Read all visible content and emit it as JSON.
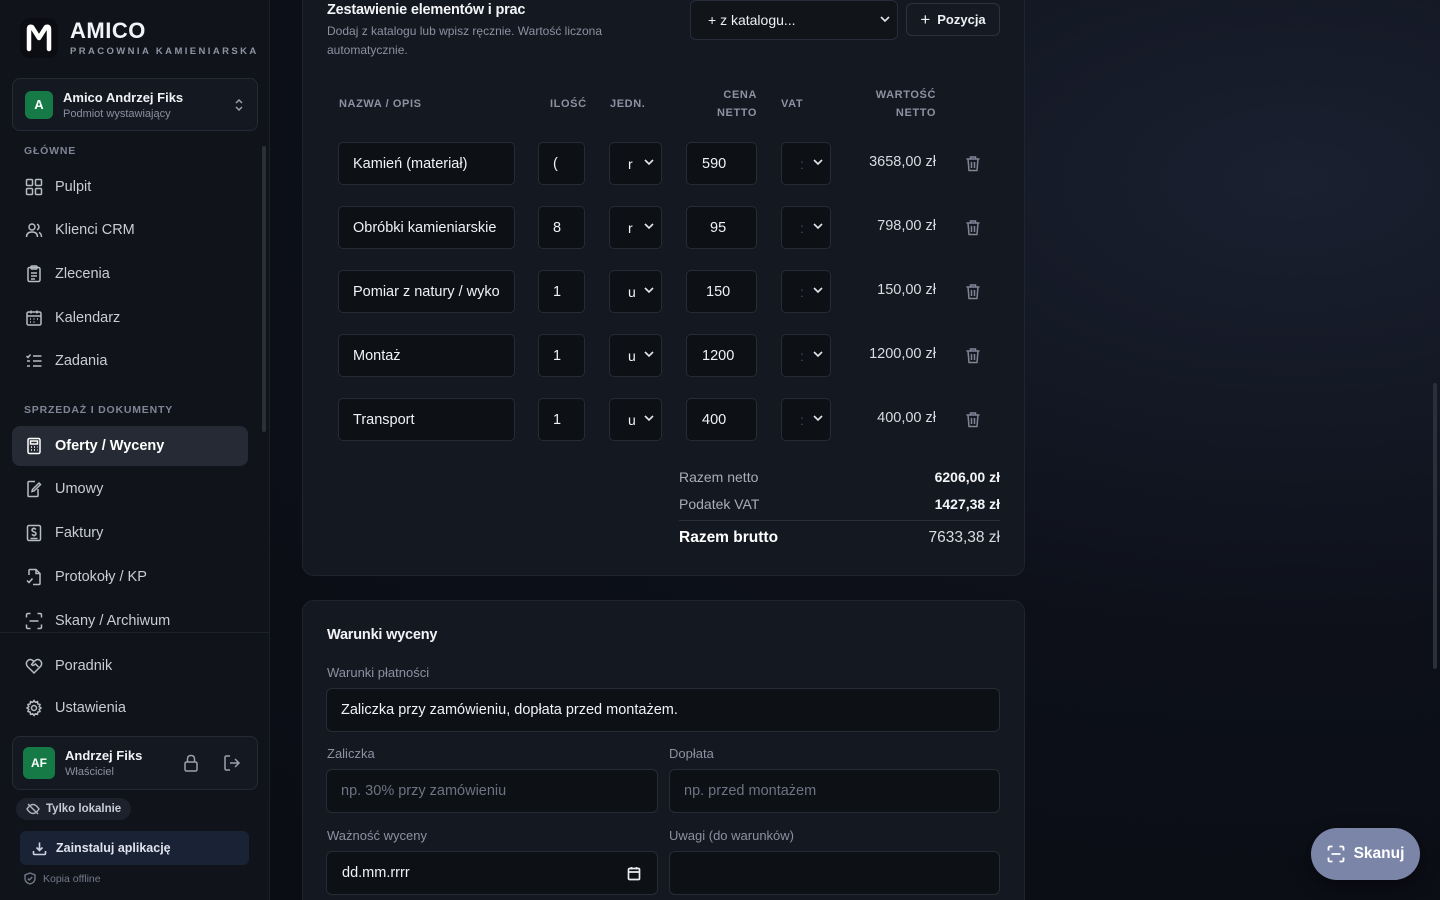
{
  "brand": {
    "name": "AMICO",
    "subtitle": "PRACOWNIA KAMIENIARSKA",
    "logo_letter": "M"
  },
  "entity": {
    "initial": "A",
    "name": "Amico Andrzej Fiks",
    "role": "Podmiot wystawiający"
  },
  "sidebar": {
    "section_main": "GŁÓWNE",
    "section_sales": "SPRZEDAŻ I DOKUMENTY",
    "items": [
      {
        "label": "Pulpit",
        "icon": "grid-icon"
      },
      {
        "label": "Klienci CRM",
        "icon": "users-icon"
      },
      {
        "label": "Zlecenia",
        "icon": "clipboard-icon"
      },
      {
        "label": "Kalendarz",
        "icon": "calendar-icon"
      },
      {
        "label": "Zadania",
        "icon": "tasks-icon"
      },
      {
        "label": "Oferty / Wyceny",
        "icon": "calculator-icon",
        "active": true
      },
      {
        "label": "Umowy",
        "icon": "contract-icon"
      },
      {
        "label": "Faktury",
        "icon": "invoice-icon"
      },
      {
        "label": "Protokoły / KP",
        "icon": "protocol-icon"
      },
      {
        "label": "Skany / Archiwum",
        "icon": "scan-icon"
      },
      {
        "label": "Poradnik",
        "icon": "heart-handshake-icon"
      },
      {
        "label": "Ustawienia",
        "icon": "gear-icon"
      }
    ]
  },
  "user": {
    "initials": "AF",
    "name": "Andrzej Fiks",
    "role": "Właściciel"
  },
  "local_badge": "Tylko lokalnie",
  "install_label": "Zainstaluj aplikację",
  "offline_label": "Kopia offline",
  "items_section": {
    "title": "Zestawienie elementów i prac",
    "description": "Dodaj z katalogu lub wpisz ręcznie. Wartość liczona automatycznie.",
    "catalog_select": "+ z katalogu...",
    "add_button": "Pozycja",
    "headers": {
      "name": "NAZWA / OPIS",
      "qty": "ILOŚĆ",
      "unit": "JEDN.",
      "price_1": "CENA",
      "price_2": "NETTO",
      "vat": "VAT",
      "value_1": "WARTOŚĆ",
      "value_2": "NETTO"
    },
    "rows": [
      {
        "name": "Kamień (materiał)",
        "qty": "(",
        "unit": "r",
        "price": "590",
        "vat": ":",
        "value": "3658,00 zł"
      },
      {
        "name": "Obróbki kamieniarskie",
        "qty": "8",
        "unit": "r",
        "price": "95",
        "vat": ":",
        "value": "798,00 zł"
      },
      {
        "name": "Pomiar z natury / wyko",
        "qty": "1",
        "unit": "u",
        "price": "150",
        "vat": ":",
        "value": "150,00 zł"
      },
      {
        "name": "Montaż",
        "qty": "1",
        "unit": "u",
        "price": "1200",
        "vat": ":",
        "value": "1200,00 zł"
      },
      {
        "name": "Transport",
        "qty": "1",
        "unit": "u",
        "price": "400",
        "vat": ":",
        "value": "400,00 zł"
      }
    ],
    "totals": {
      "net_label": "Razem netto",
      "net_value": "6206,00 zł",
      "vat_label": "Podatek VAT",
      "vat_value": "1427,38 zł",
      "gross_label": "Razem brutto",
      "gross_value": "7633,38 zł"
    }
  },
  "terms": {
    "title": "Warunki wyceny",
    "payment_label": "Warunki płatności",
    "payment_value": "Zaliczka przy zamówieniu, dopłata przed montażem.",
    "deposit_label": "Zaliczka",
    "deposit_placeholder": "np. 30% przy zamówieniu",
    "surcharge_label": "Dopłata",
    "surcharge_placeholder": "np. przed montażem",
    "validity_label": "Ważność wyceny",
    "validity_value": "dd.mm.rrrr",
    "notes_label": "Uwagi (do warunków)",
    "notes_value": ""
  },
  "scan_button": "Skanuj",
  "colors": {
    "accent_green": "#157a46",
    "scan_button": "#7b85a8",
    "active_nav": "#262a34"
  }
}
